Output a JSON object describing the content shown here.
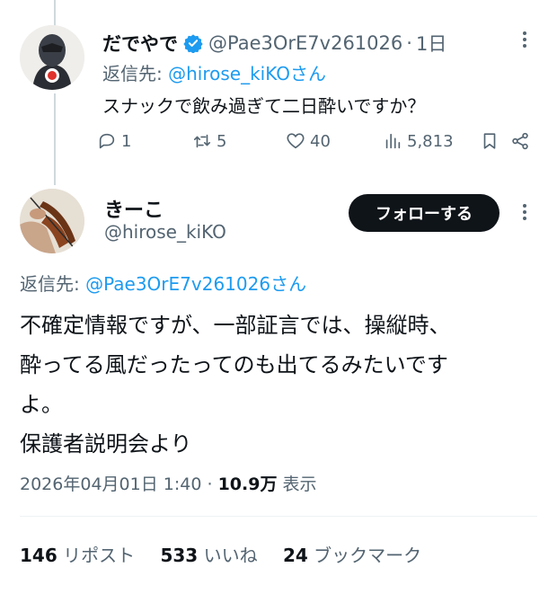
{
  "reply": {
    "name": "だでやで",
    "handle": "@Pae3OrE7v261026",
    "separator": "·",
    "time": "1日",
    "replying_prefix": "返信先: ",
    "replying_to": "@hirose_kiKOさん",
    "text": "スナックで飲み過ぎて二日酔いですか？",
    "replies": "1",
    "reposts": "5",
    "likes": "40",
    "views": "5,813"
  },
  "main": {
    "name": "きーこ",
    "handle": "@hirose_kiKO",
    "follow_label": "フォローする",
    "replying_prefix": "返信先: ",
    "replying_to": "@Pae3OrE7v261026さん",
    "text_lines": [
      "不確定情報ですが、一部証言では、操縦時、",
      "酔ってる風だったってのも出てるみたいです",
      "よ。",
      "保護者説明会より"
    ],
    "timestamp": "2026年04月01日 1:40",
    "views_count": "10.9万",
    "views_label": "表示",
    "reposts_count": "146",
    "reposts_label": "リポスト",
    "likes_count": "533",
    "likes_label": "いいね",
    "bookmarks_count": "24",
    "bookmarks_label": "ブックマーク"
  },
  "colors": {
    "accent": "#1d9bf0",
    "text": "#0f1419",
    "secondary": "#536471"
  }
}
